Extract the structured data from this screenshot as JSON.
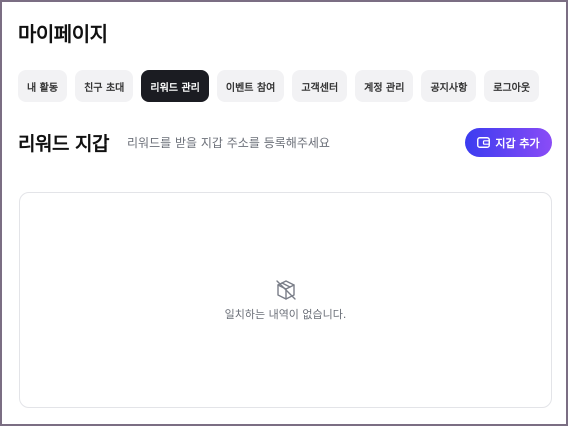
{
  "page": {
    "title": "마이페이지"
  },
  "tabs": [
    {
      "label": "내 활동",
      "active": false
    },
    {
      "label": "친구 초대",
      "active": false
    },
    {
      "label": "리워드 관리",
      "active": true
    },
    {
      "label": "이벤트 참여",
      "active": false
    },
    {
      "label": "고객센터",
      "active": false
    },
    {
      "label": "계정 관리",
      "active": false
    },
    {
      "label": "공지사항",
      "active": false
    },
    {
      "label": "로그아웃",
      "active": false
    }
  ],
  "section": {
    "title": "리워드 지갑",
    "subtitle": "리워드를 받을 지갑 주소를 등록해주세요",
    "add_button_label": "지갑 추가",
    "add_button_icon": "wallet-icon"
  },
  "empty_state": {
    "icon": "empty-box-icon",
    "message": "일치하는 내역이 없습니다."
  },
  "colors": {
    "active_tab": "#1b1c22",
    "tab_bg": "#f2f2f4",
    "button_gradient_start": "#3b3cf0",
    "button_gradient_end": "#8a4cf6"
  }
}
